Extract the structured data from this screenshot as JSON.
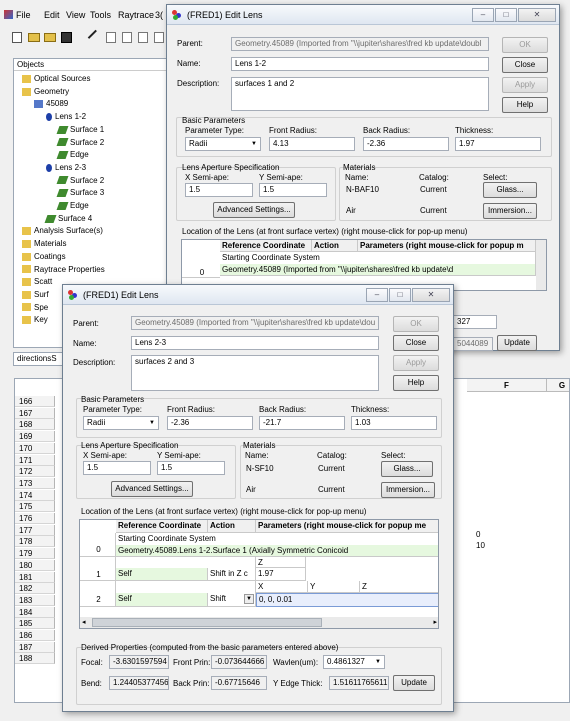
{
  "main_window": {
    "menu": [
      "File",
      "Edit",
      "View",
      "Tools",
      "Raytrace",
      "3("
    ]
  },
  "tree": {
    "header": "Objects",
    "items": [
      {
        "label": "Optical Sources",
        "icon": "folder-icon"
      },
      {
        "label": "Geometry",
        "icon": "folder-icon"
      },
      {
        "label": "45089",
        "icon": "assembly-icon"
      },
      {
        "label": "Lens 1-2",
        "icon": "lens-icon"
      },
      {
        "label": "Surface 1",
        "icon": "surface-icon"
      },
      {
        "label": "Surface 2",
        "icon": "surface-icon"
      },
      {
        "label": "Edge",
        "icon": "surface-icon"
      },
      {
        "label": "Lens 2-3",
        "icon": "lens-icon"
      },
      {
        "label": "Surface 2",
        "icon": "surface-icon"
      },
      {
        "label": "Surface 3",
        "icon": "surface-icon"
      },
      {
        "label": "Edge",
        "icon": "surface-icon"
      },
      {
        "label": "Surface 4",
        "icon": "surface-icon"
      },
      {
        "label": "Analysis Surface(s)",
        "icon": "folder-icon"
      },
      {
        "label": "Materials",
        "icon": "folder-icon"
      },
      {
        "label": "Coatings",
        "icon": "folder-icon"
      },
      {
        "label": "Raytrace Properties",
        "icon": "folder-icon"
      },
      {
        "label": "Scatt",
        "icon": "folder-icon"
      },
      {
        "label": "Surf",
        "icon": "folder-icon"
      },
      {
        "label": "Spe",
        "icon": "folder-icon"
      },
      {
        "label": "Key",
        "icon": "folder-icon"
      }
    ],
    "tab_label": "directionsS"
  },
  "spreadsheet": {
    "col_f": "F",
    "col_g": "G",
    "rows": [
      "166",
      "167",
      "168",
      "169",
      "170",
      "171",
      "172",
      "173",
      "174",
      "175",
      "176",
      "177",
      "178",
      "179",
      "180",
      "181",
      "182",
      "183",
      "184",
      "185",
      "186",
      "187",
      "188"
    ],
    "col_f_values": {
      "177": "0",
      "178": "10"
    }
  },
  "dialog1": {
    "title": "(FRED1) Edit Lens",
    "parent_label": "Parent:",
    "parent_value": "Geometry.45089   (Imported from \"\\\\jupiter\\shares\\fred kb update\\doubl",
    "name_label": "Name:",
    "name_value": "Lens 1-2",
    "desc_label": "Description:",
    "desc_value": "surfaces 1 and 2",
    "ok": "OK",
    "close": "Close",
    "apply": "Apply",
    "help": "Help",
    "basic_params": "Basic Parameters",
    "param_type_label": "Parameter Type:",
    "param_type_value": "Radii",
    "front_radius_label": "Front Radius:",
    "front_radius_value": "4.13",
    "back_radius_label": "Back Radius:",
    "back_radius_value": "-2.36",
    "thickness_label": "Thickness:",
    "thickness_value": "1.97",
    "aperture_title": "Lens Aperture Specification",
    "x_semi_label": "X Semi-ape:",
    "x_semi_value": "1.5",
    "y_semi_label": "Y Semi-ape:",
    "y_semi_value": "1.5",
    "advanced": "Advanced Settings...",
    "materials_title": "Materials",
    "mat_name_label": "Name:",
    "mat_catalog_label": "Catalog:",
    "mat_select_label": "Select:",
    "mat1_name": "N-BAF10",
    "mat1_catalog": "Current",
    "glass_btn": "Glass...",
    "mat2_name": "Air",
    "mat2_catalog": "Current",
    "immersion_btn": "Immersion...",
    "location_title": "Location of the Lens (at front surface vertex)   (right mouse-click for pop-up menu)",
    "col_ref": "Reference Coordinate",
    "col_action": "Action",
    "col_params": "Parameters (right mouse-click for popup m",
    "row0_label": "Starting Coordinate System",
    "row0_num": "0",
    "row0_ref": "Geometry.45089   (Imported from \"\\\\jupiter\\shares\\fred kb update\\d",
    "partial_wavlen": "327",
    "partial_bend": "5044089",
    "update": "Update"
  },
  "dialog2": {
    "title": "(FRED1) Edit Lens",
    "parent_label": "Parent:",
    "parent_value": "Geometry.45089   (Imported from \"\\\\jupiter\\shares\\fred kb update\\dou",
    "name_label": "Name:",
    "name_value": "Lens 2-3",
    "desc_label": "Description:",
    "desc_value": "surfaces 2 and 3",
    "ok": "OK",
    "close": "Close",
    "apply": "Apply",
    "help": "Help",
    "basic_params": "Basic Parameters",
    "param_type_label": "Parameter Type:",
    "param_type_value": "Radii",
    "front_radius_label": "Front Radius:",
    "front_radius_value": "-2.36",
    "back_radius_label": "Back Radius:",
    "back_radius_value": "-21.7",
    "thickness_label": "Thickness:",
    "thickness_value": "1.03",
    "aperture_title": "Lens Aperture Specification",
    "x_semi_label": "X Semi-ape:",
    "x_semi_value": "1.5",
    "y_semi_label": "Y Semi-ape:",
    "y_semi_value": "1.5",
    "advanced": "Advanced Settings...",
    "materials_title": "Materials",
    "mat_name_label": "Name:",
    "mat_catalog_label": "Catalog:",
    "mat_select_label": "Select:",
    "mat1_name": "N-SF10",
    "mat1_catalog": "Current",
    "glass_btn": "Glass...",
    "mat2_name": "Air",
    "mat2_catalog": "Current",
    "immersion_btn": "Immersion...",
    "location_title": "Location of the Lens (at front surface vertex)   (right mouse-click for pop-up menu)",
    "col_ref": "Reference Coordinate",
    "col_action": "Action",
    "col_params": "Parameters (right mouse-click for popup me",
    "row0_label": "Starting Coordinate System",
    "row0_num": "0",
    "row0_ref": "Geometry.45089.Lens 1-2.Surface 1   (Axially Symmetric Conicoid",
    "row1_num": "1",
    "row1_ref": "Self",
    "row1_action": "Shift in Z c",
    "row1_axis": "Z",
    "row1_value": "1.97",
    "row2_num": "2",
    "row2_ref": "Self",
    "row2_action": "Shift",
    "row2_axis_x": "X",
    "row2_axis_y": "Y",
    "row2_axis_z": "Z",
    "row2_value": "0,  0,  0.01",
    "derived_title": "Derived Properties (computed from the basic parameters entered above)",
    "focal_label": "Focal:",
    "focal_value": "-3.6301597594",
    "front_prin_label": "Front Prin:",
    "front_prin_value": "-0.073644666",
    "wavlen_label": "Wavlen(um):",
    "wavlen_value": "0.4861327",
    "bend_label": "Bend:",
    "bend_value": "1.24405377456",
    "back_prin_label": "Back Prin:",
    "back_prin_value": "-0.67715646",
    "y_edge_label": "Y Edge Thick:",
    "y_edge_value": "1.51611765611",
    "update": "Update"
  }
}
